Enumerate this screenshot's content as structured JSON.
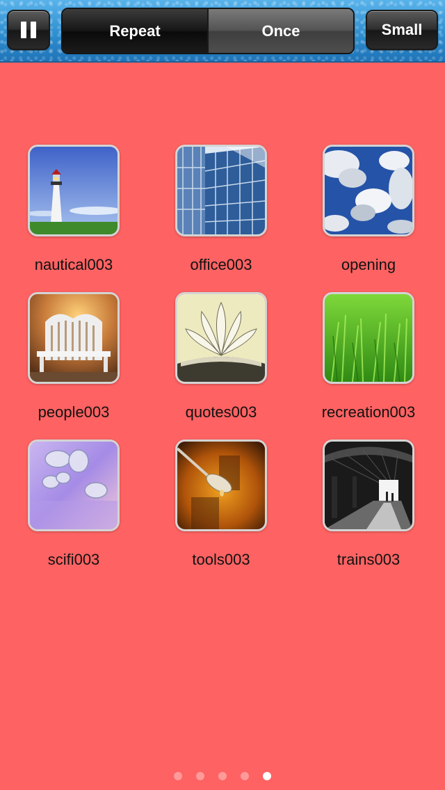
{
  "toolbar": {
    "pause_icon": "pause-icon",
    "segments": [
      {
        "label": "Repeat",
        "selected": true
      },
      {
        "label": "Once",
        "selected": false
      }
    ],
    "size_label": "Small"
  },
  "grid": {
    "items": [
      {
        "label": "nautical003",
        "icon": "lighthouse-photo"
      },
      {
        "label": "office003",
        "icon": "glass-building-photo"
      },
      {
        "label": "opening",
        "icon": "clouds-photo"
      },
      {
        "label": "people003",
        "icon": "white-chair-photo"
      },
      {
        "label": "quotes003",
        "icon": "open-book-photo"
      },
      {
        "label": "recreation003",
        "icon": "grass-photo"
      },
      {
        "label": "scifi003",
        "icon": "glass-spheres-photo"
      },
      {
        "label": "tools003",
        "icon": "spoon-photo"
      },
      {
        "label": "trains003",
        "icon": "train-station-photo"
      }
    ]
  },
  "pager": {
    "page_count": 5,
    "current_page": 5
  },
  "colors": {
    "background": "#fe6262",
    "toolbar": "#2f8fd0",
    "dot_active": "#ffffff",
    "dot_inactive": "#ff9a9a"
  }
}
